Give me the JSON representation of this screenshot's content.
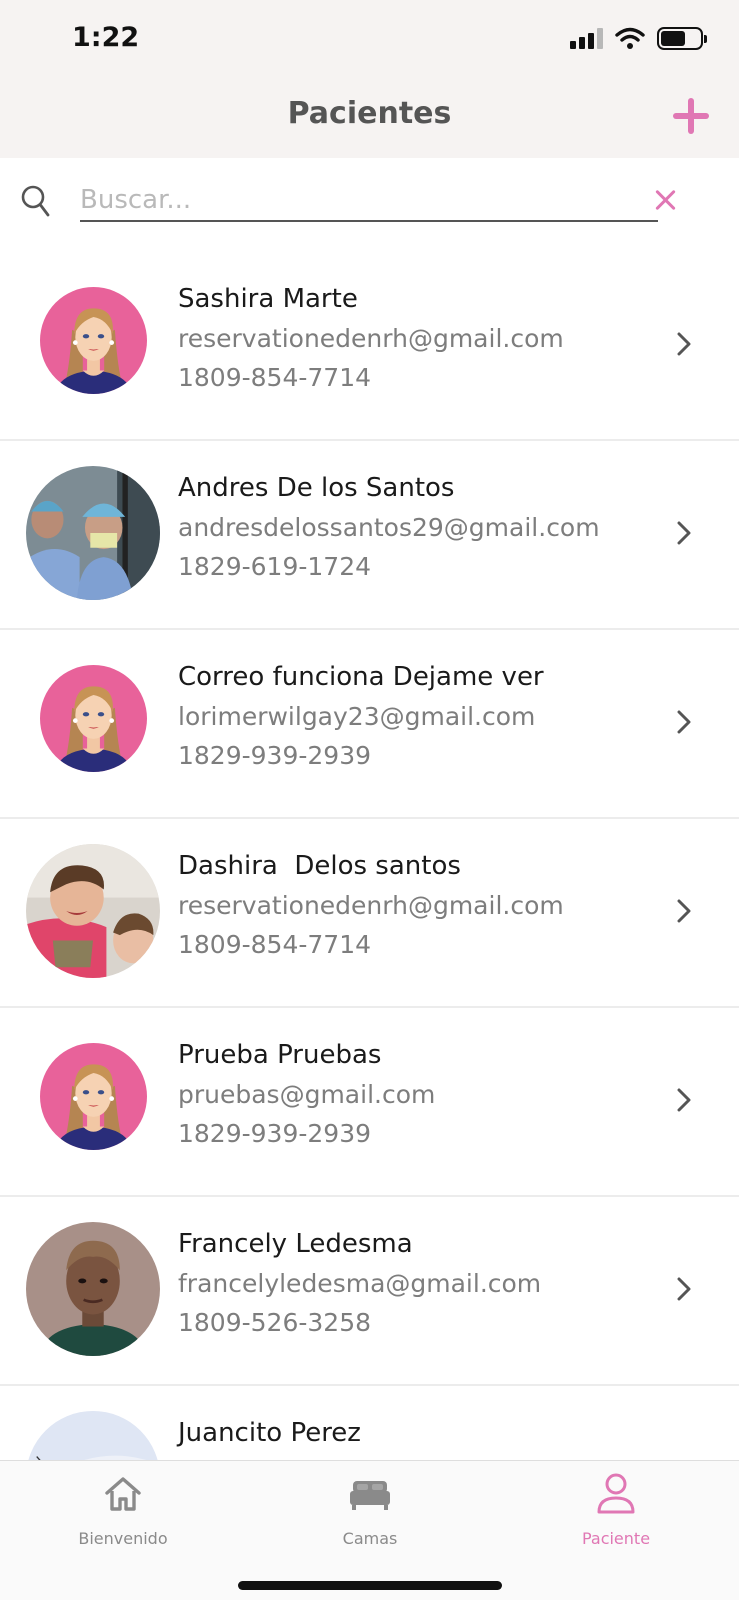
{
  "status_bar": {
    "time": "1:22"
  },
  "header": {
    "title": "Pacientes"
  },
  "search": {
    "placeholder": "Buscar..."
  },
  "patients": [
    {
      "name": "Sashira Marte",
      "email": "reservationedenrh@gmail.com",
      "phone": "1809-854-7714",
      "avatar": "default-female-avatar"
    },
    {
      "name": "Andres De los Santos",
      "email": "andresdelossantos29@gmail.com",
      "phone": "1829-619-1724",
      "avatar": "surgeon-photo"
    },
    {
      "name": "Correo funciona Dejame ver",
      "email": "lorimerwilgay23@gmail.com",
      "phone": "1829-939-2939",
      "avatar": "default-female-avatar"
    },
    {
      "name": "Dashira  Delos santos",
      "email": "reservationedenrh@gmail.com",
      "phone": "1809-854-7714",
      "avatar": "children-photo"
    },
    {
      "name": "Prueba Pruebas",
      "email": "pruebas@gmail.com",
      "phone": "1829-939-2939",
      "avatar": "default-female-avatar"
    },
    {
      "name": "Francely Ledesma",
      "email": "francelyledesma@gmail.com",
      "phone": "1809-526-3258",
      "avatar": "woman-photo"
    },
    {
      "name": "Juancito Perez",
      "email": "",
      "phone": "",
      "avatar": "light-photo"
    }
  ],
  "tabbar": {
    "tabs": [
      {
        "label": "Bienvenido",
        "icon": "home-icon",
        "active": false
      },
      {
        "label": "Camas",
        "icon": "bed-icon",
        "active": false
      },
      {
        "label": "Paciente",
        "icon": "person-icon",
        "active": true
      }
    ]
  },
  "colors": {
    "accent": "#e077b4",
    "header_bg": "#f6f3f2"
  }
}
